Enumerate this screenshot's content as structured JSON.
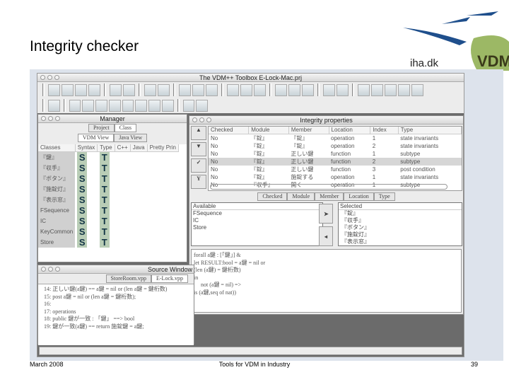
{
  "slide": {
    "title": "Integrity checker",
    "date": "March 2008",
    "footer": "Tools for VDM in Industry",
    "page": "39",
    "logo_text": "iha.dk",
    "logo_vdm": "VDM"
  },
  "app": {
    "title": "The VDM++ Toolbox E-Lock-Mac.prj",
    "toolbar1": [
      "new",
      "open",
      "save",
      "save-as",
      "doc",
      "doc2",
      "edit",
      "edit2",
      "AI",
      "clip",
      "trash",
      "stop",
      "close",
      "int",
      "check",
      "check2",
      "check3",
      "vdm-cpp",
      "vdm-java",
      "pp",
      "vdm",
      "win1",
      "win2",
      "win3"
    ],
    "toolbar2": [
      "flag",
      "list1",
      "list2",
      "list3",
      "green1",
      "green2",
      "green3",
      "green4",
      "frame",
      "?",
      "help2"
    ]
  },
  "manager": {
    "title": "Manager",
    "tabs": [
      "Project",
      "Class"
    ],
    "subtabs": [
      "VDM View",
      "Java View"
    ],
    "columns": [
      "Classes",
      "Syntax",
      "Type",
      "C++",
      "Java",
      "Pretty Prin"
    ],
    "classes": [
      "『鍵』",
      "『収手』",
      "『ボタン』",
      "『施錠灯』",
      "『表示窓』",
      "FSequence",
      "IC",
      "KeyCommon",
      "Store"
    ],
    "syntax": "S",
    "type": "T"
  },
  "integrity": {
    "title": "Integrity properties",
    "columns": [
      "Checked",
      "Module",
      "Member",
      "Location",
      "Index",
      "Type"
    ],
    "rows": [
      [
        "No",
        "『錠』",
        "『錠』",
        "operation",
        "1",
        "state invariants"
      ],
      [
        "No",
        "『錠』",
        "『錠』",
        "operation",
        "2",
        "state invariants"
      ],
      [
        "No",
        "『錠』",
        "正しい鍵",
        "function",
        "1",
        "subtype"
      ],
      [
        "No",
        "『錠』",
        "正しい鍵",
        "function",
        "2",
        "subtype"
      ],
      [
        "No",
        "『錠』",
        "正しい鍵",
        "function",
        "3",
        "post condition"
      ],
      [
        "No",
        "『錠』",
        "施錠する",
        "operation",
        "1",
        "state invariants"
      ],
      [
        "No",
        "『収手』",
        "開く",
        "operation",
        "1",
        "subtype"
      ]
    ],
    "sort_tabs": [
      "Checked",
      "Module",
      "Member",
      "Location",
      "Type"
    ],
    "available_header": "Available",
    "available": [
      "FSequence",
      "IC",
      "Store"
    ],
    "selected_header": "Selected",
    "selected": [
      "『錠』",
      "『収手』",
      "『ボタン』",
      "『施錠灯』",
      "『表示窓』"
    ],
    "code": [
      "forall a鍵 : [「鍵」] &",
      "let RESULT:bool = a鍵 = nil or",
      "(len (a鍵) = 鍵桁数)",
      "in",
      "not (a鍵 = nil) =>",
      "is (a鍵,seq of nat))"
    ]
  },
  "source": {
    "title": "Source Window",
    "tabs": [
      "StoreRoom.vpp",
      "E-Lock.vpp"
    ],
    "lines": [
      "14: 正しい鍵(a鍵) ==   a鍵 = nil or (len a鍵 = 鍵桁数)",
      "15: post            a鍵 = nil or (len a鍵 = 鍵桁数);",
      "16:",
      "17: operations",
      "18: public 鍵が一致 : 「鍵」 ==> bool",
      "19: 鍵が一致(a鍵) == return 施錠鍵 = a鍵;"
    ]
  }
}
